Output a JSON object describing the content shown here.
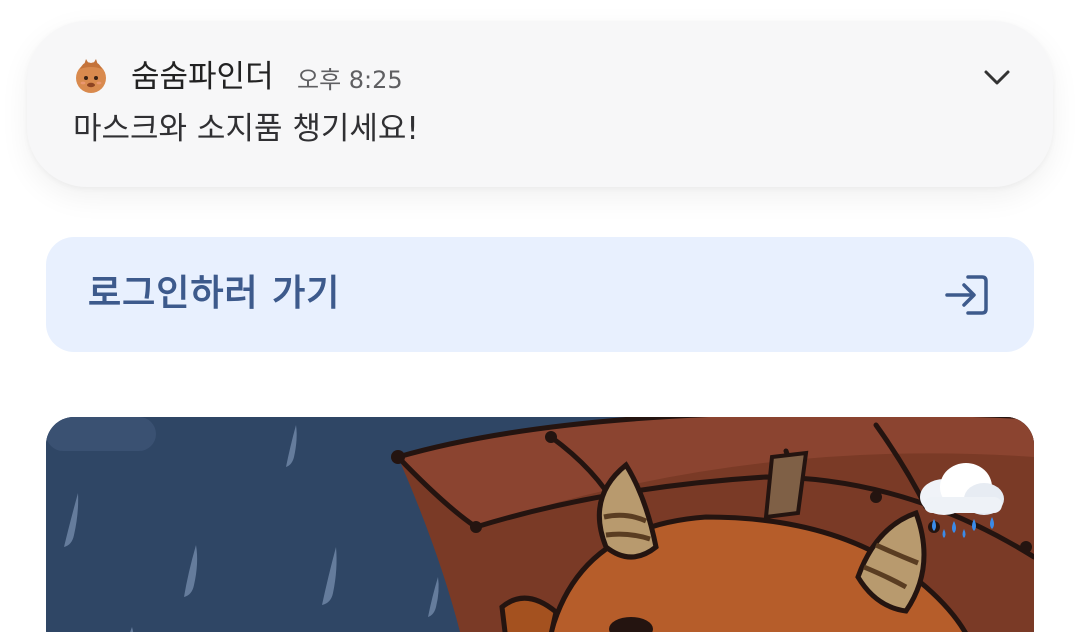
{
  "notification": {
    "app_icon": "character-face-icon",
    "app_name": "숨숨파인더",
    "time": "오후 8:25",
    "message": "마스크와 소지품 챙기세요!",
    "expand_icon": "chevron-down-icon"
  },
  "login": {
    "label": "로그인하러 가기",
    "icon": "sign-in-icon"
  },
  "banner": {
    "illustration": "horned-character-under-umbrella-in-rain",
    "weather_icon": "rain-cloud-icon"
  },
  "colors": {
    "login_bg": "#e8f0fe",
    "login_text": "#3d5a8c",
    "rain_sky": "#2f4665",
    "umbrella": "#7a3a26"
  }
}
